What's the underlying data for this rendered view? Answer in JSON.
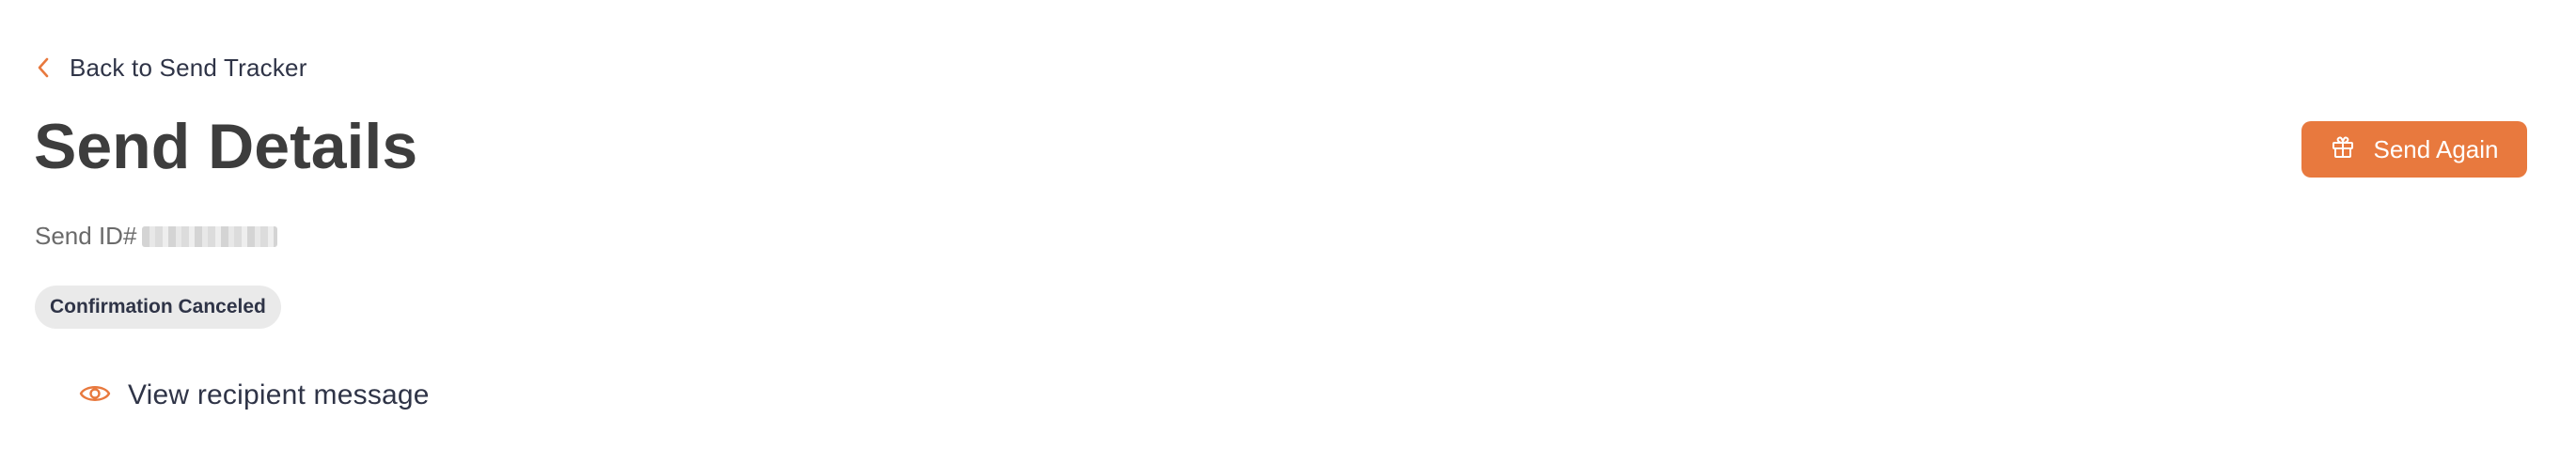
{
  "nav": {
    "back_label": "Back to Send Tracker"
  },
  "header": {
    "title": "Send Details",
    "send_again_label": "Send Again"
  },
  "details": {
    "send_id_label": "Send ID#",
    "status": "Confirmation Canceled",
    "view_message_label": "View recipient message"
  },
  "icons": {
    "back": "chevron-left-icon",
    "send_again": "gift-icon",
    "view_message": "eye-icon"
  },
  "colors": {
    "accent": "#e8793e",
    "badge_bg": "#eaeaea",
    "text_dark": "#2f3447",
    "title": "#3d3d3d"
  }
}
